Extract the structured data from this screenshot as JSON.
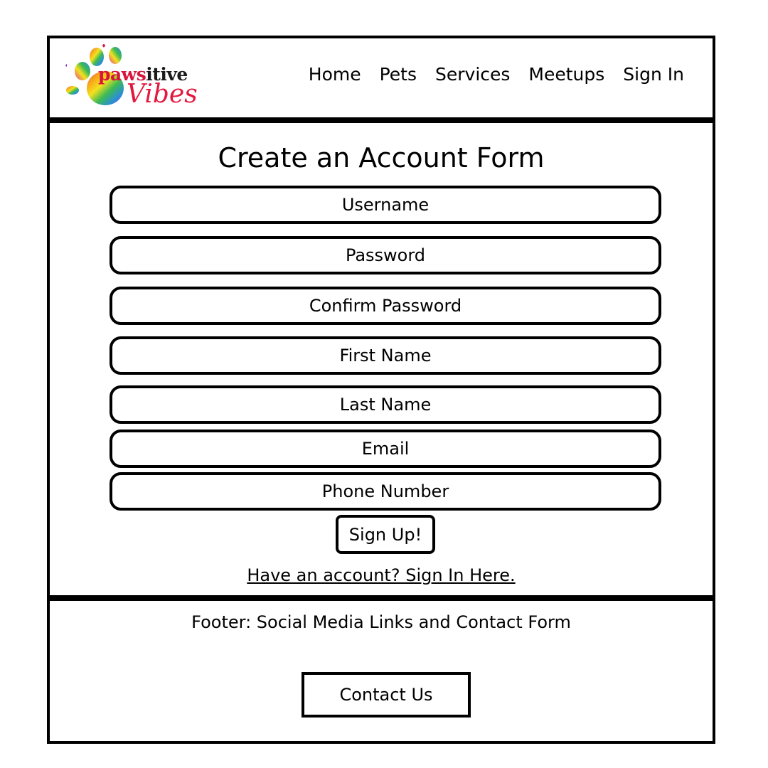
{
  "header": {
    "logo": {
      "text_main": "paws",
      "text_rest": "itive",
      "text_sub": "Vibes",
      "icon": "paw-print-icon",
      "colors": [
        "#d6143c",
        "#f7a21b",
        "#f4e11e",
        "#3cba54",
        "#2a8fd8",
        "#8e3bbf",
        "#e0408f"
      ]
    },
    "nav": [
      "Home",
      "Pets",
      "Services",
      "Meetups",
      "Sign In"
    ]
  },
  "form": {
    "title": "Create an Account Form",
    "fields": [
      {
        "placeholder": "Username"
      },
      {
        "placeholder": "Password"
      },
      {
        "placeholder": "Confirm Password"
      },
      {
        "placeholder": "First Name"
      },
      {
        "placeholder": "Last Name"
      },
      {
        "placeholder": "Email"
      },
      {
        "placeholder": "Phone Number"
      }
    ],
    "submit_label": "Sign Up!",
    "signin_link": "Have an account? Sign In Here."
  },
  "footer": {
    "text": "Footer: Social Media Links and Contact Form",
    "contact_label": "Contact Us"
  }
}
